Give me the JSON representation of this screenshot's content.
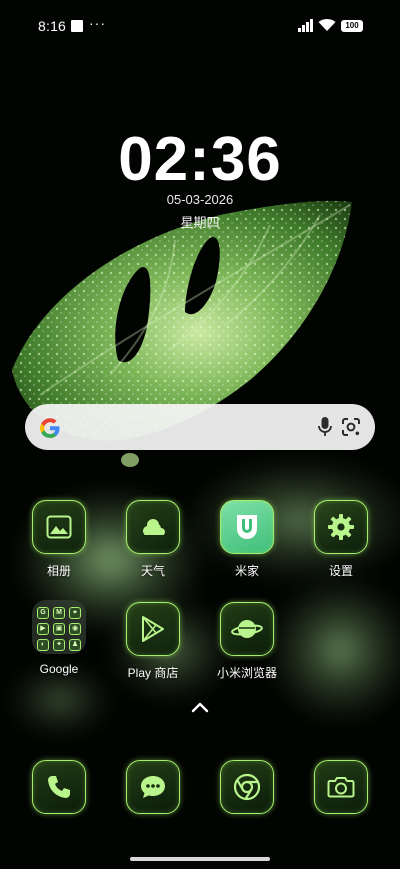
{
  "status_bar": {
    "time": "8:16",
    "more": "···",
    "battery": "100"
  },
  "lockscreen": {
    "clock": "02:36",
    "date": "05-03-2026",
    "weekday": "星期四"
  },
  "search": {
    "icons": [
      "google-g-icon",
      "microphone-icon",
      "lens-icon"
    ]
  },
  "apps_row1": [
    {
      "label": "相册",
      "icon": "gallery-icon"
    },
    {
      "label": "天气",
      "icon": "weather-icon"
    },
    {
      "label": "米家",
      "icon": "mi-home-icon"
    },
    {
      "label": "设置",
      "icon": "settings-gear-icon"
    }
  ],
  "apps_row2": [
    {
      "label": "Google",
      "icon": "folder-icon"
    },
    {
      "label": "Play 商店",
      "icon": "play-store-icon"
    },
    {
      "label": "小米浏览器",
      "icon": "browser-planet-icon"
    }
  ],
  "folder_apps": [
    "G",
    "M",
    "⌖",
    "▶",
    "▣",
    "◉",
    "◐",
    "✦",
    "♟"
  ],
  "dock": [
    {
      "icon": "phone-icon"
    },
    {
      "icon": "messages-icon"
    },
    {
      "icon": "chrome-icon"
    },
    {
      "icon": "camera-icon"
    }
  ],
  "colors": {
    "accent": "#a7ee6e",
    "icon_bg": "#16300f"
  }
}
